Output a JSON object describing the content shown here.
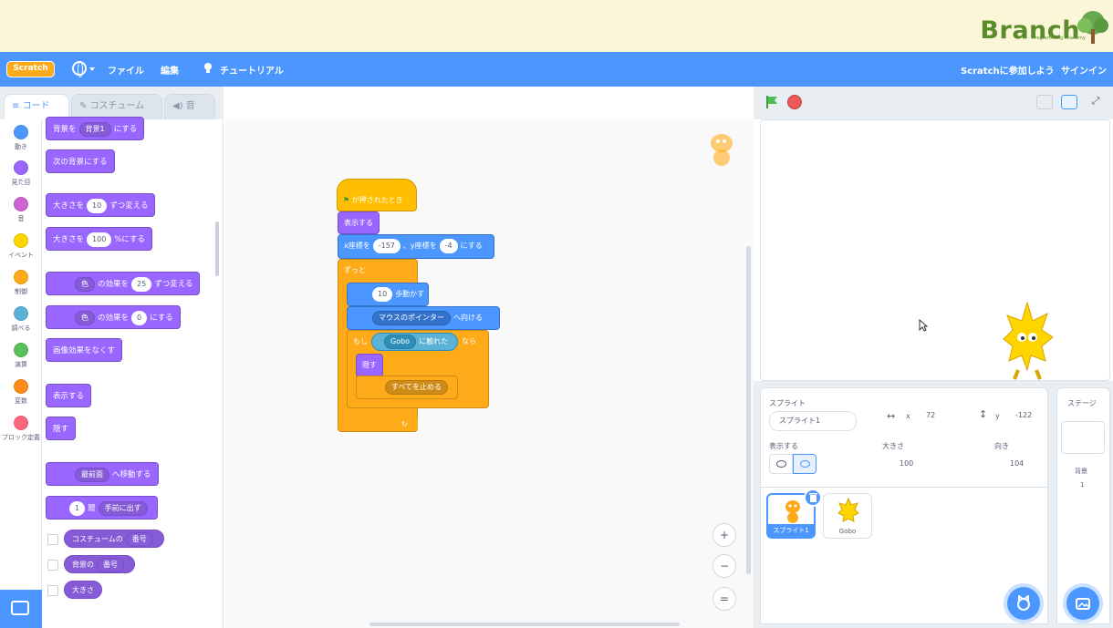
{
  "banner": {
    "brand": "Branch",
    "brand_sub": "Programming Academy"
  },
  "menubar": {
    "logo": "Scratch",
    "file": "ファイル",
    "edit": "編集",
    "tutorials": "チュートリアル",
    "join": "Scratchに参加しよう",
    "signin": "サインイン",
    "accent": "#4c97ff"
  },
  "tabs": {
    "code": "コード",
    "costumes": "コスチューム",
    "sounds": "音"
  },
  "categories": [
    {
      "label": "動き",
      "color": "#4c97ff"
    },
    {
      "label": "見た目",
      "color": "#9966ff"
    },
    {
      "label": "音",
      "color": "#cf63cf"
    },
    {
      "label": "イベント",
      "color": "#ffd500"
    },
    {
      "label": "制御",
      "color": "#ffab19"
    },
    {
      "label": "調べる",
      "color": "#5cb1d6"
    },
    {
      "label": "演算",
      "color": "#59c059"
    },
    {
      "label": "変数",
      "color": "#ff8c1a"
    },
    {
      "label": "ブロック定義",
      "color": "#ff6680"
    }
  ],
  "palette": {
    "switch_backdrop_a": "背景を",
    "switch_backdrop_dd": "背景1",
    "switch_backdrop_b": "にする",
    "next_backdrop": "次の背景にする",
    "change_size_a": "大きさを",
    "change_size_val": "10",
    "change_size_b": "ずつ変える",
    "set_size_a": "大きさを",
    "set_size_val": "100",
    "set_size_b": "%にする",
    "change_effect_dd": "色",
    "change_effect_a": "の効果を",
    "change_effect_val": "25",
    "change_effect_b": "ずつ変える",
    "set_effect_dd": "色",
    "set_effect_a": "の効果を",
    "set_effect_val": "0",
    "set_effect_b": "にする",
    "clear_effects": "画像効果をなくす",
    "show": "表示する",
    "hide": "隠す",
    "goto_layer_dd": "最前面",
    "goto_layer_b": "へ移動する",
    "layer_val": "1",
    "layer_a": "層",
    "layer_dd": "手前に出す",
    "costume_rep_a": "コスチュームの",
    "costume_rep_dd": "番号",
    "backdrop_rep_a": "背景の",
    "backdrop_rep_dd": "番号",
    "size_rep": "大きさ"
  },
  "script": {
    "hat": "が押されたとき",
    "show": "表示する",
    "goto_a": "x座標を",
    "goto_x": "-157",
    "goto_b": "、y座標を",
    "goto_y": "-4",
    "goto_c": "にする",
    "forever": "ずっと",
    "move_val": "10",
    "move_b": "歩動かす",
    "point_dd": "マウスのポインター",
    "point_b": "へ向ける",
    "if_a": "もし",
    "touch_dd": "Gobo",
    "touch_b": "に触れた",
    "if_b": "なら",
    "hide": "隠す",
    "stop_dd": "すべてを止める"
  },
  "zoom": {
    "in": "+",
    "out": "−",
    "reset": "="
  },
  "sprite_info": {
    "label": "スプライト",
    "name": "スプライト1",
    "x_label": "x",
    "x": "72",
    "y_label": "y",
    "y": "-122",
    "show_label": "表示する",
    "size_label": "大きさ",
    "size": "100",
    "direction_label": "向き",
    "direction": "104"
  },
  "sprites": [
    {
      "name": "スプライト1"
    },
    {
      "name": "Gobo"
    }
  ],
  "stage_pane": {
    "title": "ステージ",
    "backdrops_label": "背景",
    "backdrops_count": "1"
  }
}
